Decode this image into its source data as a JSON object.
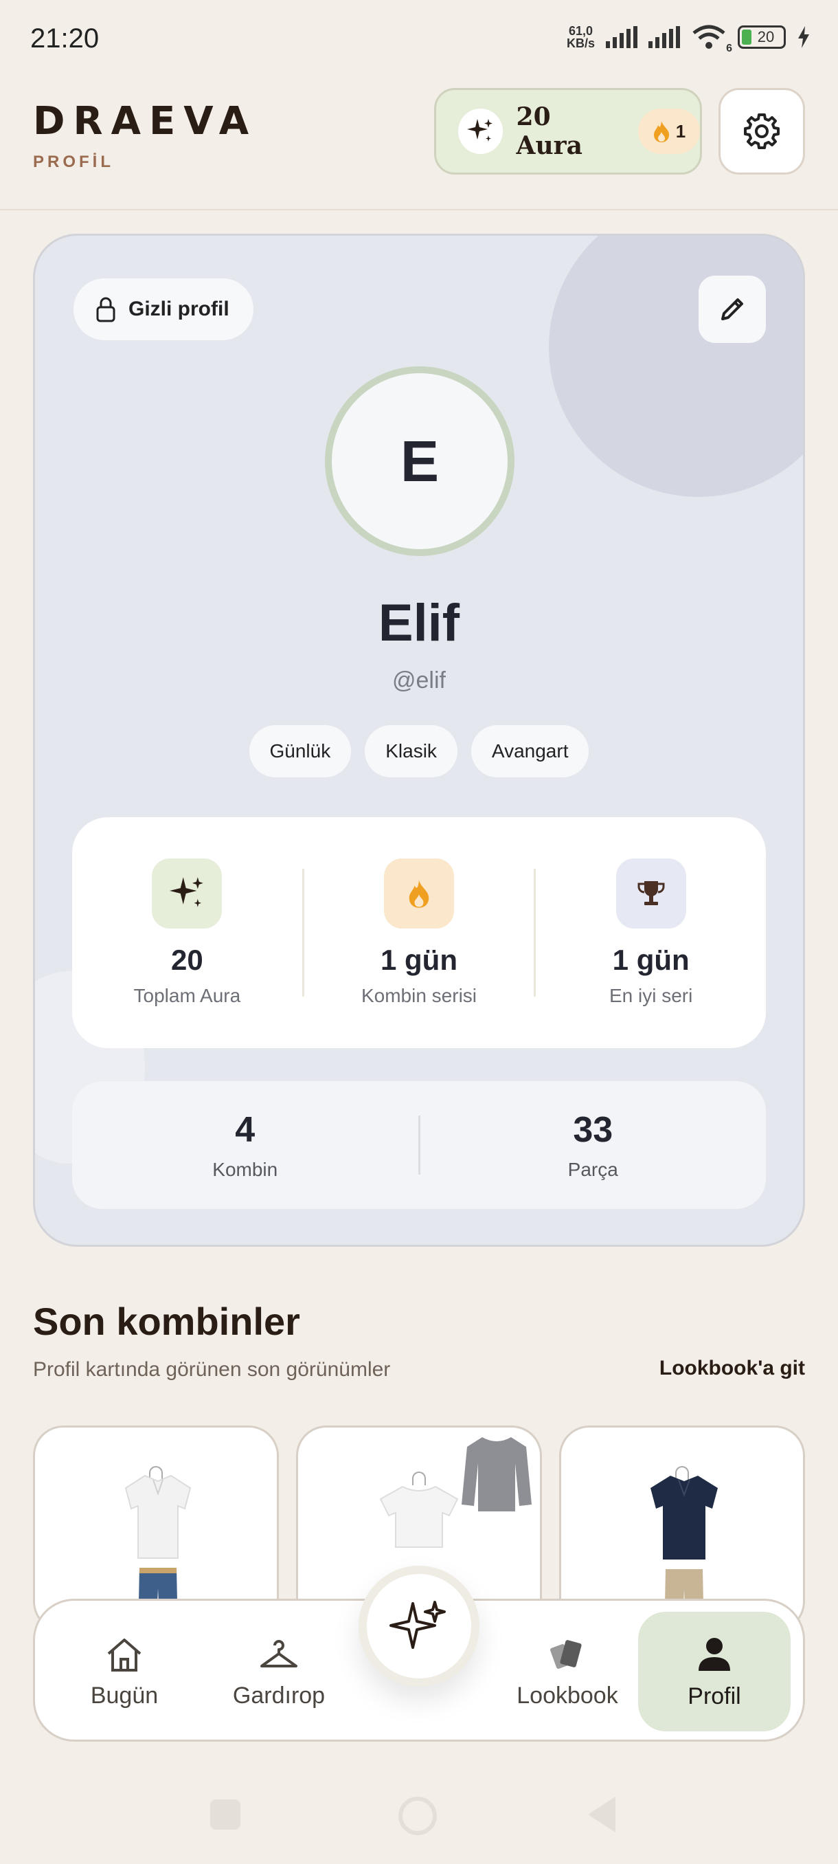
{
  "status_bar": {
    "time": "21:20",
    "net_speed_value": "61,0",
    "net_speed_unit": "KB/s",
    "wifi_label": "6",
    "battery": "20"
  },
  "header": {
    "brand": "DRAEVA",
    "subtitle": "PROFİL",
    "aura_label": "20 Aura",
    "streak_count": "1"
  },
  "profile": {
    "private_label": "Gizli profil",
    "avatar_initial": "E",
    "name": "Elif",
    "handle": "@elif",
    "tags": [
      "Günlük",
      "Klasik",
      "Avangart"
    ],
    "stats": [
      {
        "value": "20",
        "label": "Toplam Aura",
        "icon": "sparkle-icon",
        "bg": "#e6eeda"
      },
      {
        "value": "1 gün",
        "label": "Kombin serisi",
        "icon": "flame-icon",
        "bg": "#fbe7cc"
      },
      {
        "value": "1 gün",
        "label": "En iyi seri",
        "icon": "trophy-icon",
        "bg": "#e6e9f4"
      }
    ],
    "counts": [
      {
        "value": "4",
        "label": "Kombin"
      },
      {
        "value": "33",
        "label": "Parça"
      }
    ]
  },
  "recent": {
    "title": "Son kombinler",
    "subtitle": "Profil kartında görünen son görünümler",
    "link": "Lookbook'a git"
  },
  "nav": {
    "items": [
      "Bugün",
      "Gardırop",
      "Lookbook",
      "Profil"
    ],
    "active": "Profil"
  },
  "colors": {
    "background": "#f3efe8",
    "accent_green": "#dfe8d6",
    "card": "#e5e7ef",
    "brand_text": "#2a1d15",
    "flame": "#f0a020"
  }
}
